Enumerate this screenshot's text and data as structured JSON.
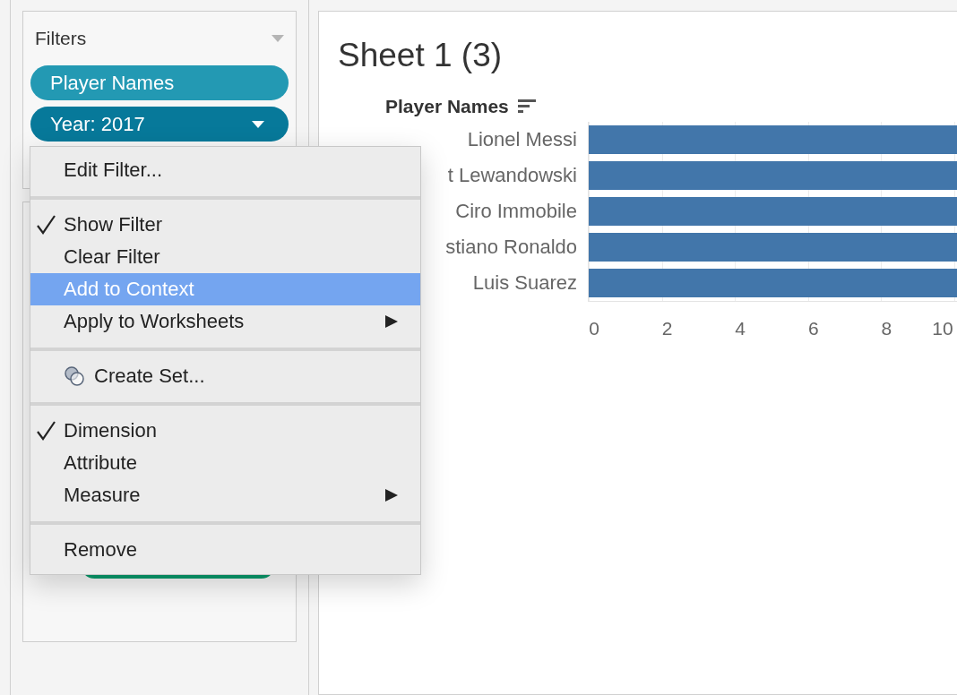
{
  "filters_panel": {
    "title": "Filters",
    "pills": [
      {
        "label": "Player Names",
        "kind": "plain"
      },
      {
        "label": "Year: 2017",
        "kind": "dropdown"
      }
    ]
  },
  "marks_panel": {
    "pills": [
      {
        "kind": "hidden"
      }
    ]
  },
  "sheet": {
    "title": "Sheet 1 (3)",
    "row_header": "Player Names",
    "rows": [
      {
        "label": "Lionel Messi"
      },
      {
        "label": "t Lewandowski"
      },
      {
        "label": "Ciro Immobile"
      },
      {
        "label": "stiano Ronaldo"
      },
      {
        "label": "Luis Suarez"
      }
    ],
    "axis_ticks": [
      "0",
      "2",
      "4",
      "6",
      "8",
      "10"
    ]
  },
  "context_menu": {
    "sections": [
      {
        "items": [
          {
            "label": "Edit Filter...",
            "checked": false,
            "selected": false,
            "submenu": false
          }
        ]
      },
      {
        "items": [
          {
            "label": "Show Filter",
            "checked": true,
            "selected": false,
            "submenu": false
          },
          {
            "label": "Clear Filter",
            "checked": false,
            "selected": false,
            "submenu": false
          },
          {
            "label": "Add to Context",
            "checked": false,
            "selected": true,
            "submenu": false
          },
          {
            "label": "Apply to Worksheets",
            "checked": false,
            "selected": false,
            "submenu": true
          }
        ]
      },
      {
        "items": [
          {
            "label": "Create Set...",
            "checked": false,
            "selected": false,
            "submenu": false,
            "icon": true
          }
        ]
      },
      {
        "items": [
          {
            "label": "Dimension",
            "checked": true,
            "selected": false,
            "submenu": false
          },
          {
            "label": "Attribute",
            "checked": false,
            "selected": false,
            "submenu": false
          },
          {
            "label": "Measure",
            "checked": false,
            "selected": false,
            "submenu": true
          }
        ]
      },
      {
        "items": [
          {
            "label": "Remove",
            "checked": false,
            "selected": false,
            "submenu": false
          }
        ]
      }
    ]
  }
}
